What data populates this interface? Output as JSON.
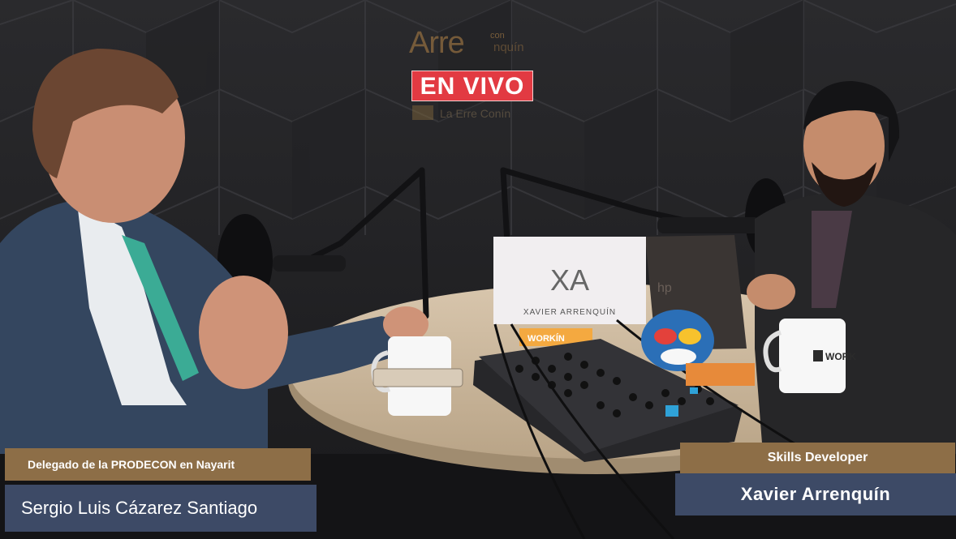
{
  "overlay": {
    "logo_main": "Arre",
    "logo_con": "con",
    "logo_rest": "nquín",
    "live_badge": "EN VIVO",
    "sub_logo": "La Erre Conín"
  },
  "lower_thirds": {
    "left": {
      "title": "Delegado de la PRODECON en Nayarit",
      "name": "Sergio Luis Cázarez Santiago"
    },
    "right": {
      "title": "Skills Developer",
      "name": "Xavier Arrenquín"
    }
  },
  "props": {
    "mug_text": "WORK",
    "sign_monogram": "XA",
    "sign_name": "XAVIER ARRENQUÍN",
    "sign_strip": "WORKÍN"
  },
  "colors": {
    "live_red": "#e23a42",
    "title_bar": "#8d6e47",
    "name_bar": "#3d4a66"
  }
}
